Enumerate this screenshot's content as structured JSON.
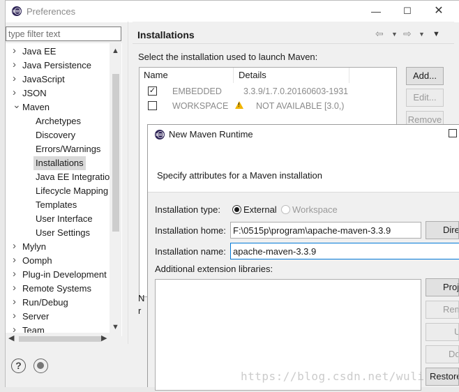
{
  "window": {
    "title": "Preferences",
    "controls": {
      "minimize": "—",
      "maximize": "☐",
      "close": "✕"
    }
  },
  "filter": {
    "placeholder": "type filter text",
    "value": ""
  },
  "tree": {
    "items": [
      {
        "label": "Java EE",
        "expanded": false
      },
      {
        "label": "Java Persistence",
        "expanded": false
      },
      {
        "label": "JavaScript",
        "expanded": false
      },
      {
        "label": "JSON",
        "expanded": false
      },
      {
        "label": "Maven",
        "expanded": true
      },
      {
        "label": "Archetypes",
        "child": true
      },
      {
        "label": "Discovery",
        "child": true
      },
      {
        "label": "Errors/Warnings",
        "child": true
      },
      {
        "label": "Installations",
        "child": true,
        "selected": true
      },
      {
        "label": "Java EE Integration",
        "child": true
      },
      {
        "label": "Lifecycle Mapping",
        "child": true
      },
      {
        "label": "Templates",
        "child": true
      },
      {
        "label": "User Interface",
        "child": true
      },
      {
        "label": "User Settings",
        "child": true
      },
      {
        "label": "Mylyn",
        "expanded": false
      },
      {
        "label": "Oomph",
        "expanded": false
      },
      {
        "label": "Plug-in Development",
        "expanded": false
      },
      {
        "label": "Remote Systems",
        "expanded": false
      },
      {
        "label": "Run/Debug",
        "expanded": false
      },
      {
        "label": "Server",
        "expanded": false
      },
      {
        "label": "Team",
        "expanded": false
      }
    ]
  },
  "page": {
    "title": "Installations",
    "prompt": "Select the installation used to launch Maven:",
    "table": {
      "headers": {
        "name": "Name",
        "details": "Details"
      },
      "rows": [
        {
          "checked": true,
          "name": "EMBEDDED",
          "details": "3.3.9/1.7.0.20160603-1931"
        },
        {
          "checked": false,
          "name": "WORKSPACE",
          "details": "NOT AVAILABLE [3.0,)",
          "warning": true
        }
      ]
    },
    "buttons": {
      "add": "Add...",
      "edit": "Edit...",
      "remove": "Remove"
    },
    "partial_texts": {
      "n": "N",
      "r": "r"
    }
  },
  "dialog": {
    "title": "New Maven Runtime",
    "description": "Specify attributes for a Maven installation",
    "installation_type_label": "Installation type:",
    "type_options": {
      "external": "External",
      "workspace": "Workspace",
      "selected": "external"
    },
    "home_label": "Installation home:",
    "home_value": "F:\\0515p\\program\\apache-maven-3.3.9",
    "directory_button": "Direc",
    "name_label": "Installation name:",
    "name_value": "apache-maven-3.3.9",
    "ext_label": "Additional extension libraries:",
    "side_buttons": {
      "project": "Proj",
      "remove": "Rem",
      "up": "U",
      "down": "Do",
      "restore": "Restore"
    }
  },
  "watermark": "https://blog.csdn.net/wuli"
}
